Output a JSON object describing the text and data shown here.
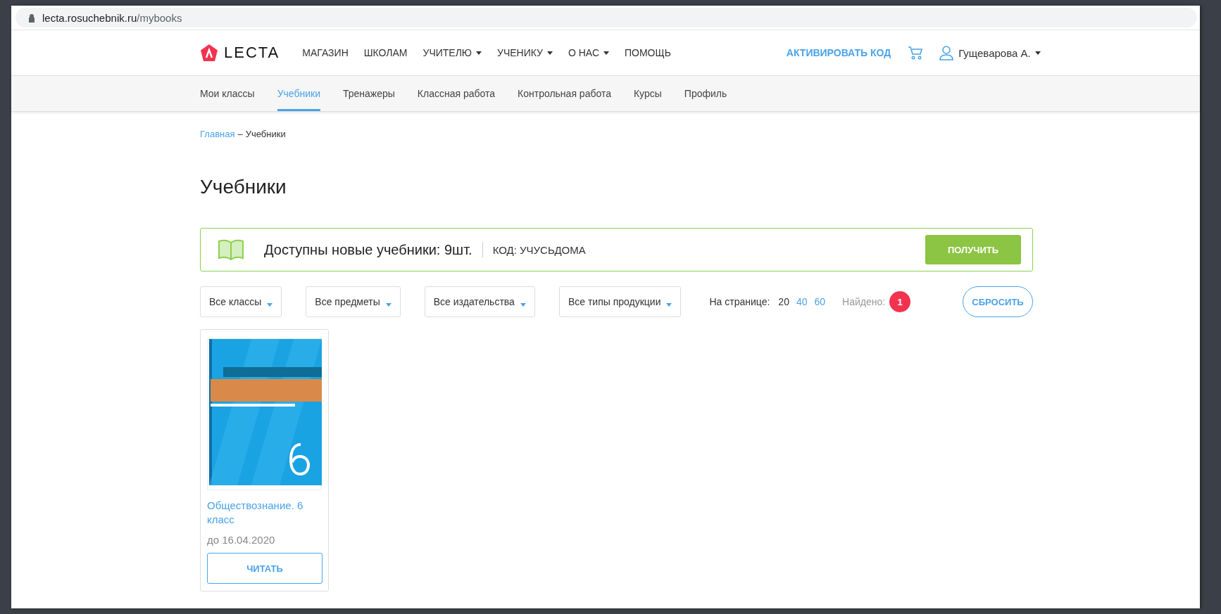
{
  "address_bar": {
    "host": "lecta.rosuchebnik.ru",
    "path": "/mybooks"
  },
  "header": {
    "logo": "LECTA",
    "nav": [
      {
        "label": "МАГАЗИН",
        "dropdown": false
      },
      {
        "label": "ШКОЛАМ",
        "dropdown": false
      },
      {
        "label": "УЧИТЕЛЮ",
        "dropdown": true
      },
      {
        "label": "УЧЕНИКУ",
        "dropdown": true
      },
      {
        "label": "О НАС",
        "dropdown": true
      },
      {
        "label": "ПОМОЩЬ",
        "dropdown": false
      }
    ],
    "activate": "АКТИВИРОВАТЬ КОД",
    "user": "Гущеварова А."
  },
  "tabs": [
    {
      "label": "Мои классы",
      "selected": false
    },
    {
      "label": "Учебники",
      "selected": true
    },
    {
      "label": "Тренажеры",
      "selected": false
    },
    {
      "label": "Классная работа",
      "selected": false
    },
    {
      "label": "Контрольная работа",
      "selected": false
    },
    {
      "label": "Курсы",
      "selected": false
    },
    {
      "label": "Профиль",
      "selected": false
    }
  ],
  "breadcrumb": {
    "link": "Главная",
    "separator": "–",
    "current": "Учебники"
  },
  "title": "Учебники",
  "banner": {
    "text": "Доступны новые учебники: 9шт.",
    "code": "КОД: УЧУСЬДОМА",
    "button": "ПОЛУЧИТЬ"
  },
  "filters": [
    "Все классы",
    "Все предметы",
    "Все издательства",
    "Все типы продукции"
  ],
  "per_page": {
    "label": "На странице:",
    "options": [
      {
        "label": "20",
        "selected": true
      },
      {
        "label": "40",
        "selected": false
      },
      {
        "label": "60",
        "selected": false
      }
    ]
  },
  "found": {
    "label": "Найдено:",
    "count": "1"
  },
  "reset": "СБРОСИТЬ",
  "books": [
    {
      "title": "Обществознание. 6 класс",
      "until": "до 16.04.2020",
      "button": "ЧИТАТЬ"
    }
  ]
}
